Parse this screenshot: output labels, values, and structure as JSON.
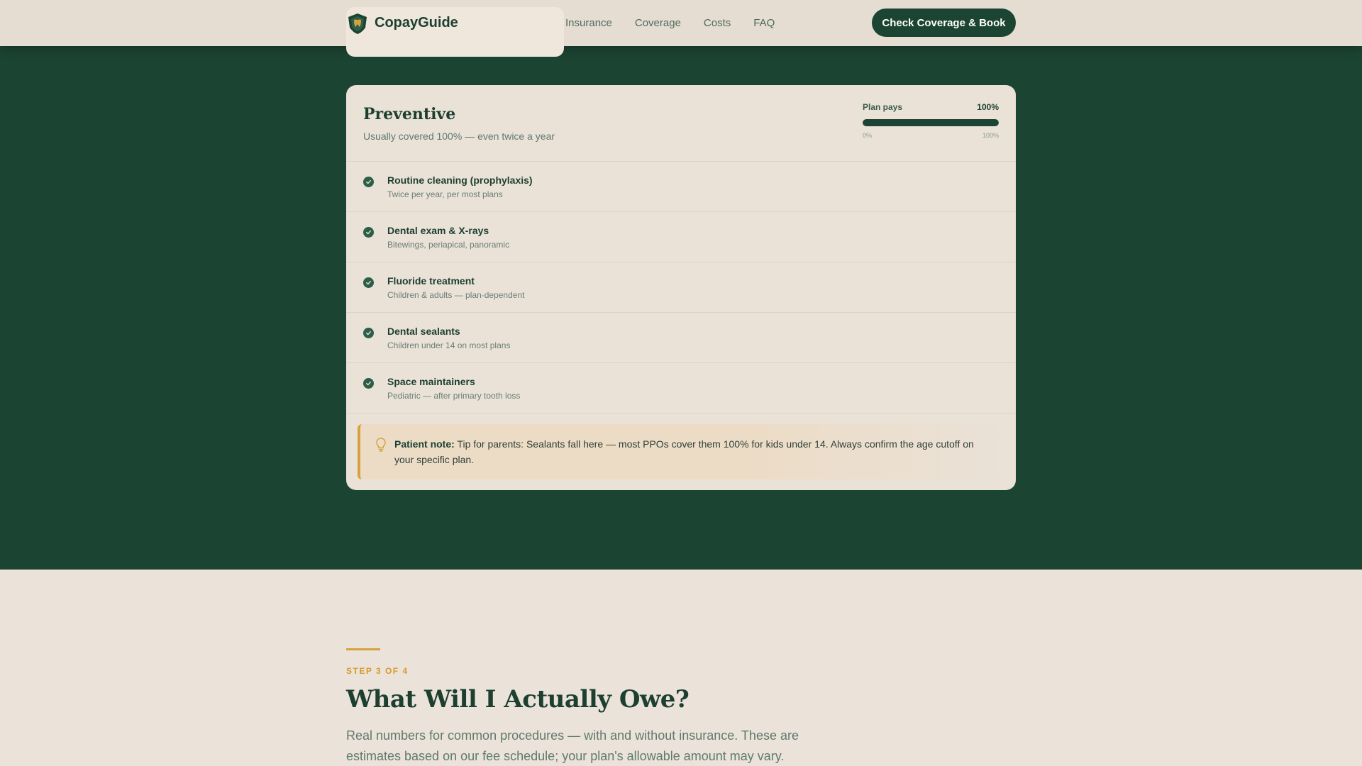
{
  "brand": {
    "name": "CopayGuide",
    "logo_icon": "shield-tooth-logo"
  },
  "nav": {
    "items": [
      {
        "label": "Insurance"
      },
      {
        "label": "Coverage"
      },
      {
        "label": "Costs"
      },
      {
        "label": "FAQ"
      }
    ],
    "cta_label": "Check Coverage & Book"
  },
  "card": {
    "title": "Preventive",
    "subtitle": "Usually covered 100% — even twice a year",
    "meter": {
      "label": "Plan pays",
      "value_label": "100%",
      "value_percent": 100,
      "scale_min": "0%",
      "scale_max": "100%"
    },
    "items": [
      {
        "title": "Routine cleaning (prophylaxis)",
        "detail": "Twice per year, per most plans"
      },
      {
        "title": "Dental exam & X-rays",
        "detail": "Bitewings, periapical, panoramic"
      },
      {
        "title": "Fluoride treatment",
        "detail": "Children & adults — plan-dependent"
      },
      {
        "title": "Dental sealants",
        "detail": "Children under 14 on most plans"
      },
      {
        "title": "Space maintainers",
        "detail": "Pediatric — after primary tooth loss"
      }
    ],
    "note": {
      "label": "Patient note:",
      "text": "Tip for parents: Sealants fall here — most PPOs cover them 100% for kids under 14. Always confirm the age cutoff on your specific plan.",
      "icon": "lightbulb-icon"
    }
  },
  "section": {
    "eyebrow": "STEP 3 OF 4",
    "heading": "What Will I Actually Owe?",
    "lead": "Real numbers for common procedures — with and without insurance. These are estimates based on our fee schedule; your plan's allowable amount may vary."
  },
  "colors": {
    "brand_green": "#1c4433",
    "accent_gold": "#d6a23e",
    "cream": "#eae1d7"
  }
}
